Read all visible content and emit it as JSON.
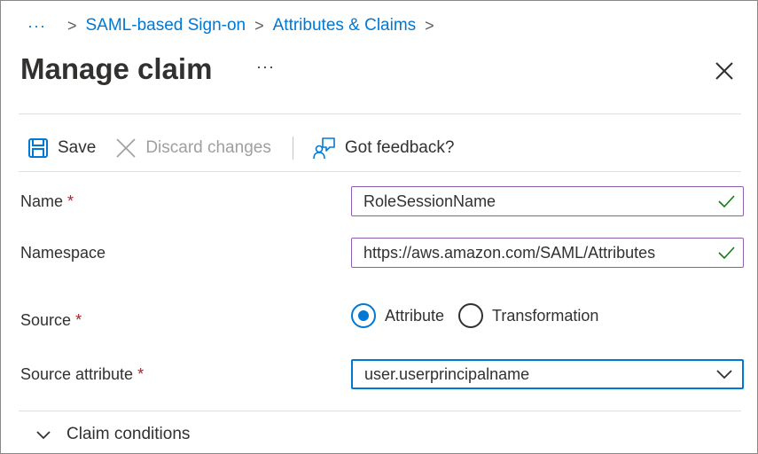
{
  "breadcrumb": {
    "ellipsis": "···",
    "items": [
      "SAML-based Sign-on",
      "Attributes & Claims"
    ],
    "separator": ">"
  },
  "header": {
    "title": "Manage claim",
    "more": "···",
    "close_icon": "close-icon"
  },
  "toolbar": {
    "save_label": "Save",
    "discard_label": "Discard changes",
    "feedback_label": "Got feedback?"
  },
  "form": {
    "name": {
      "label": "Name",
      "required": "*",
      "value": "RoleSessionName"
    },
    "namespace": {
      "label": "Namespace",
      "value": "https://aws.amazon.com/SAML/Attributes"
    },
    "source": {
      "label": "Source",
      "required": "*",
      "options": [
        {
          "label": "Attribute",
          "checked": true
        },
        {
          "label": "Transformation",
          "checked": false
        }
      ]
    },
    "source_attribute": {
      "label": "Source attribute",
      "required": "*",
      "value": "user.userprincipalname"
    }
  },
  "claim_conditions": {
    "label": "Claim conditions"
  },
  "colors": {
    "accent": "#0078d4",
    "valid_border": "#8c5fb5",
    "valid_check": "#107c10",
    "required": "#a4262c"
  }
}
